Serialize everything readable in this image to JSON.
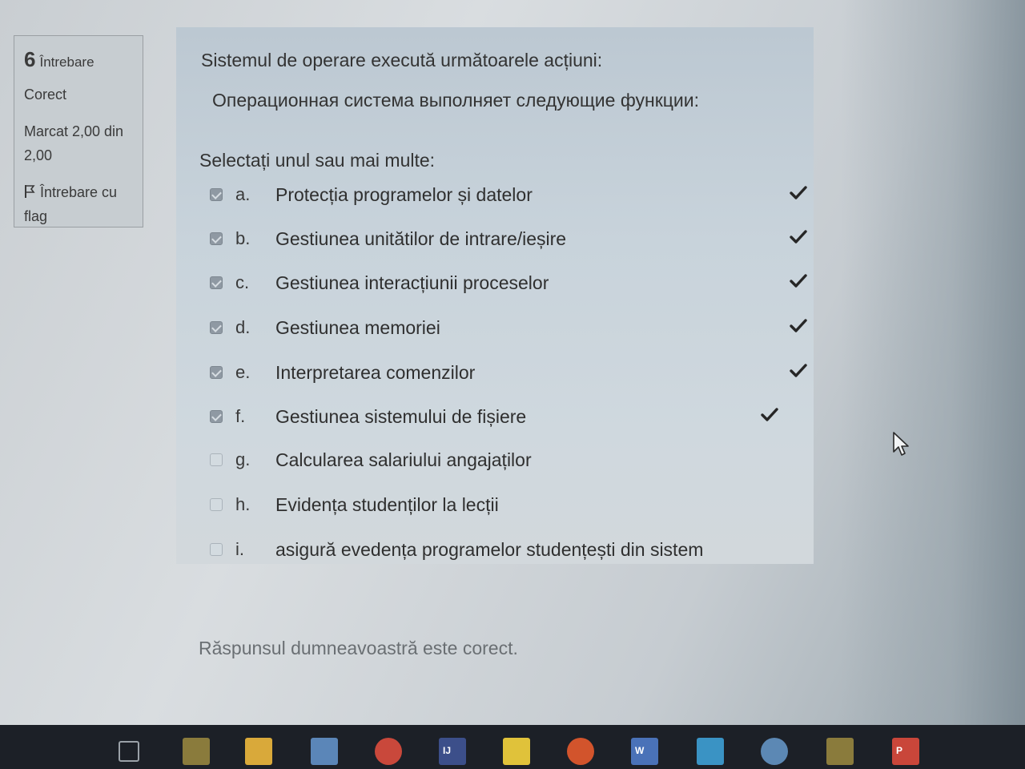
{
  "info": {
    "question_number": "6",
    "question_label": "Întrebare",
    "state": "Corect",
    "grade": "Marcat 2,00 din 2,00",
    "flag_label": "Întrebare cu flag"
  },
  "question": {
    "text_ro": "Sistemul de operare execută următoarele acțiuni:",
    "text_ru": "Операционная система выполняет следующие функции:",
    "prompt": "Selectați unul sau mai multe:"
  },
  "options": [
    {
      "letter": "a.",
      "text": "Protecția programelor și datelor",
      "checked": true,
      "correct": true
    },
    {
      "letter": "b.",
      "text": "Gestiunea unitătilor de intrare/ieșire",
      "checked": true,
      "correct": true
    },
    {
      "letter": "c.",
      "text": "Gestiunea interacțiunii proceselor",
      "checked": true,
      "correct": true
    },
    {
      "letter": "d.",
      "text": "Gestiunea memoriei",
      "checked": true,
      "correct": true
    },
    {
      "letter": "e.",
      "text": "Interpretarea comenzilor",
      "checked": true,
      "correct": true
    },
    {
      "letter": "f.",
      "text": "Gestiunea sistemului de fișiere",
      "checked": true,
      "correct": true
    },
    {
      "letter": "g.",
      "text": "Calcularea salariului angajaților",
      "checked": false,
      "correct": false
    },
    {
      "letter": "h.",
      "text": "Evidența studenților la lecții",
      "checked": false,
      "correct": false
    },
    {
      "letter": "i.",
      "text": "asigură evedența programelor studențești din sistem",
      "checked": false,
      "correct": false
    }
  ],
  "feedback": "Răspunsul dumneavoastră este corect.",
  "taskbar": {
    "icons": [
      {
        "name": "task-view-icon",
        "label": "",
        "color": "#9aa1a8"
      },
      {
        "name": "chart-app-icon",
        "label": "",
        "color": "#8a7b3c"
      },
      {
        "name": "file-explorer-icon",
        "label": "",
        "color": "#d9a93a"
      },
      {
        "name": "mail-icon",
        "label": "",
        "color": "#5b86b8"
      },
      {
        "name": "chrome-icon",
        "label": "",
        "color": "#c9483b"
      },
      {
        "name": "ide-icon",
        "label": "IJ",
        "color": "#3c4f8a"
      },
      {
        "name": "sticky-notes-icon",
        "label": "",
        "color": "#e0c23a"
      },
      {
        "name": "ubuntu-icon",
        "label": "",
        "color": "#d2542c"
      },
      {
        "name": "word-icon",
        "label": "W",
        "color": "#4a72b8"
      },
      {
        "name": "video-call-icon",
        "label": "",
        "color": "#3a93c4"
      },
      {
        "name": "globe-icon",
        "label": "",
        "color": "#5c88b4"
      },
      {
        "name": "chart-app-2-icon",
        "label": "",
        "color": "#8a7b3c"
      },
      {
        "name": "powerpoint-icon",
        "label": "P",
        "color": "#c9463a"
      }
    ]
  }
}
